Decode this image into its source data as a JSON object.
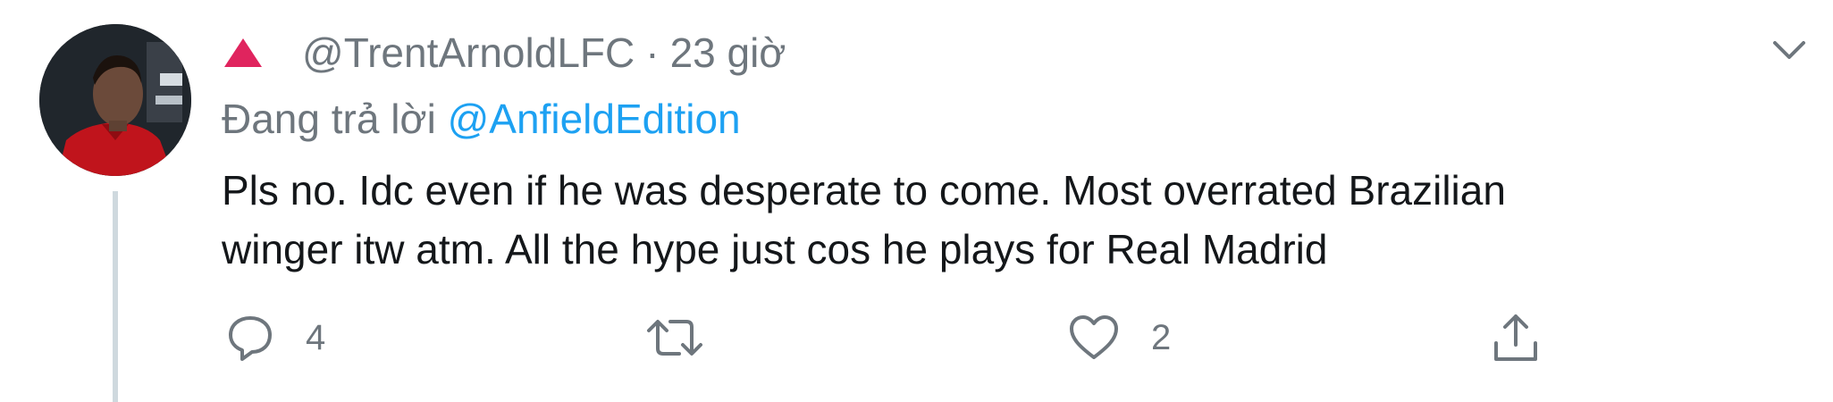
{
  "tweet": {
    "handle": "@TrentArnoldLFC",
    "separator": "·",
    "time": "23 giờ",
    "reply_prefix": "Đang trả lời ",
    "reply_mention": "@AnfieldEdition",
    "text_line1": "Pls no. Idc even if he was desperate to come. Most overrated Brazilian",
    "text_line2": "winger itw atm. All the hype just cos he plays for Real Madrid",
    "badge_color": "#e0245e",
    "mention_color": "#1da1f2"
  },
  "actions": {
    "reply": {
      "icon": "reply-icon",
      "count": "4"
    },
    "retweet": {
      "icon": "retweet-icon",
      "count": ""
    },
    "like": {
      "icon": "heart-icon",
      "count": "2"
    },
    "share": {
      "icon": "share-icon"
    }
  },
  "menu": {
    "icon": "chevron-down-icon"
  }
}
